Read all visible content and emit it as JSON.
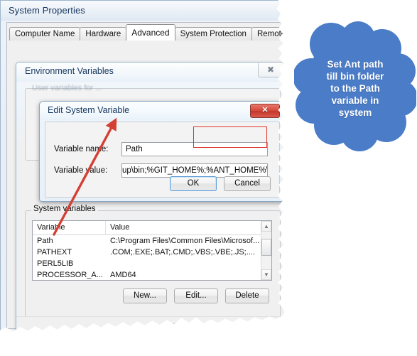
{
  "window": {
    "title": "System Properties",
    "tabs": [
      {
        "label": "Computer Name",
        "active": false
      },
      {
        "label": "Hardware",
        "active": false
      },
      {
        "label": "Advanced",
        "active": true
      },
      {
        "label": "System Protection",
        "active": false
      },
      {
        "label": "Remote",
        "active": false
      }
    ],
    "footer": {
      "ok": "OK",
      "cancel": "Cancel"
    }
  },
  "env_dialog": {
    "title": "Environment Variables",
    "close_glyph": "✖",
    "user_vars_legend": "User variables for ..."
  },
  "edit_dialog": {
    "title": "Edit System Variable",
    "close_glyph": "✕",
    "name_label": "Variable name:",
    "name_value": "Path",
    "value_label": "Variable value:",
    "value_value": "ǝp\\bin;%GIT_HOME%;%ANT_HOME%\\bin",
    "value_display": "up\\bin;%GIT_HOME%;%ANT_HOME%\\bin",
    "ok": "OK",
    "cancel": "Cancel"
  },
  "system_vars": {
    "legend": "System variables",
    "columns": [
      "Variable",
      "Value"
    ],
    "rows": [
      {
        "variable": "Path",
        "value": "C:\\Program Files\\Common Files\\Microsof..."
      },
      {
        "variable": "PATHEXT",
        "value": ".COM;.EXE;.BAT;.CMD;.VBS;.VBE;.JS;...."
      },
      {
        "variable": "PERL5LIB",
        "value": ""
      },
      {
        "variable": "PROCESSOR_A...",
        "value": "AMD64"
      }
    ],
    "buttons": {
      "new": "New...",
      "edit": "Edit...",
      "delete": "Delete"
    },
    "scroll_up_glyph": "▲",
    "scroll_down_glyph": "▼"
  },
  "annotation": {
    "callout_text": "Set Ant path till bin folder to the Path variable in system",
    "callout_line1": "Set Ant path",
    "callout_line2": "till bin folder",
    "callout_line3": "to the Path",
    "callout_line4": "variable in",
    "callout_line5": "system",
    "callout_color": "#4a7cc8",
    "arrow_color": "#d43f34",
    "highlight_color": "#e0342a"
  }
}
